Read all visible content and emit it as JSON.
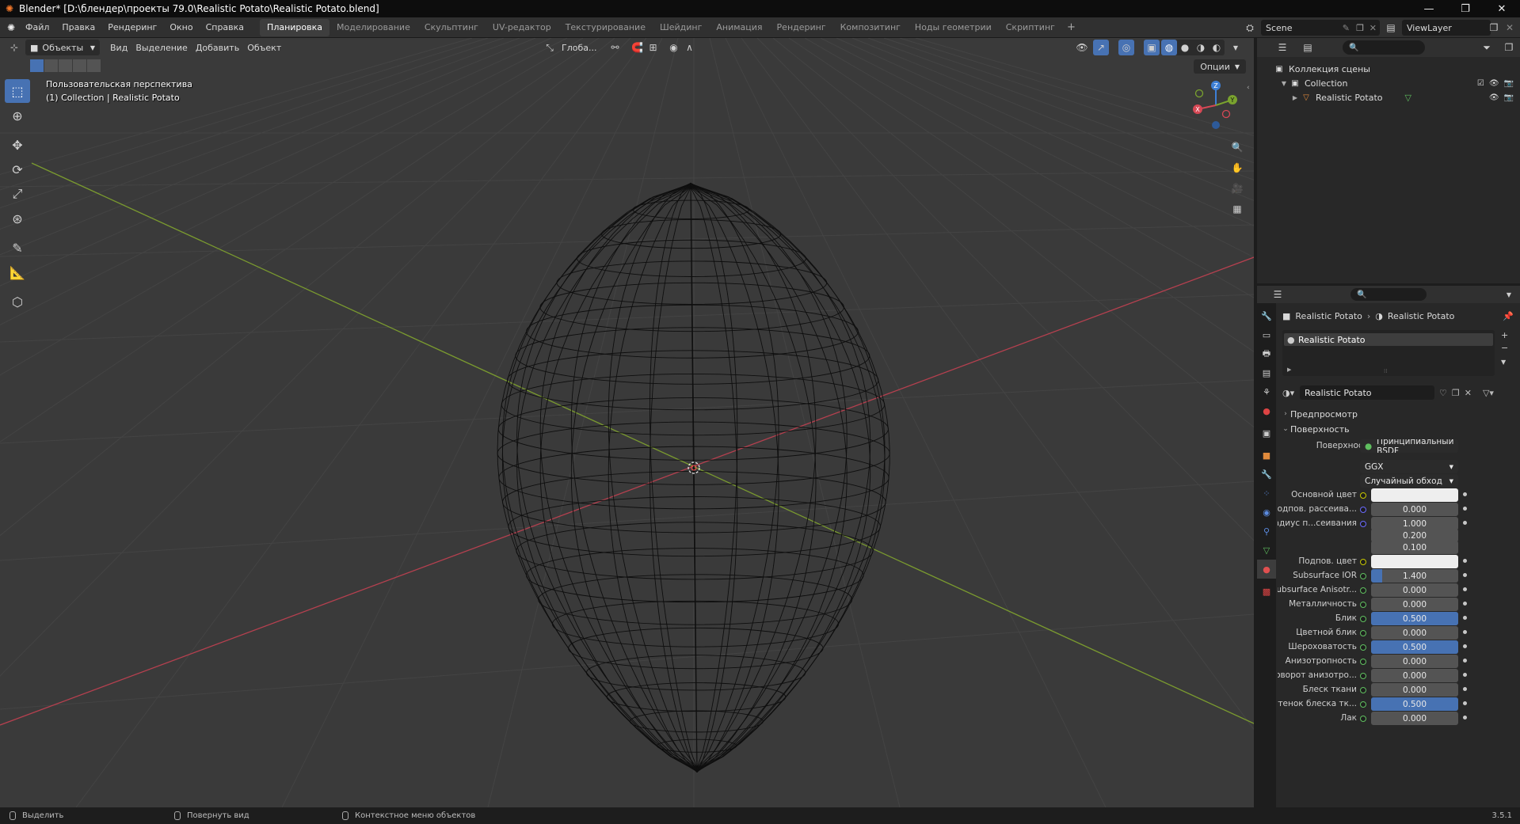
{
  "window": {
    "title": "Blender* [D:\\блендер\\проекты 79.0\\Realistic Potato\\Realistic Potato.blend]"
  },
  "menu": [
    "Файл",
    "Правка",
    "Рендеринг",
    "Окно",
    "Справка"
  ],
  "workspaces": [
    "Планировка",
    "Моделирование",
    "Скульптинг",
    "UV-редактор",
    "Текстурирование",
    "Шейдинг",
    "Анимация",
    "Рендеринг",
    "Композитинг",
    "Ноды геометрии",
    "Скриптинг"
  ],
  "scene": {
    "name": "Scene",
    "view_layer": "ViewLayer"
  },
  "viewport": {
    "mode": "Объекты",
    "menus": [
      "Вид",
      "Выделение",
      "Добавить",
      "Объект"
    ],
    "transform_orientation": "Глоба...",
    "options_label": "Опции",
    "info_line1": "Пользовательская перспектива",
    "info_line2": "(1) Collection | Realistic Potato",
    "gizmo": {
      "x": "X",
      "y": "Y",
      "z": "Z"
    }
  },
  "outliner": {
    "scene_collection": "Коллекция сцены",
    "collection": "Collection",
    "object": "Realistic Potato"
  },
  "properties": {
    "breadcrumb_object": "Realistic Potato",
    "breadcrumb_material": "Realistic Potato",
    "slot": "Realistic Potato",
    "material_name": "Realistic Potato",
    "panel_preview": "Предпросмотр",
    "panel_surface": "Поверхность",
    "surface_label": "Поверхность",
    "surface_value": "Принципиальный BSDF",
    "distribution": "GGX",
    "subsurface_method": "Случайный обход",
    "rows": [
      {
        "label": "Основной цвет",
        "value": "",
        "type": "color",
        "dot": "y"
      },
      {
        "label": "Подпов. рассеива...",
        "value": "0.000",
        "fill": 0,
        "dot": "b"
      },
      {
        "label": "Радиус п...сеивания",
        "value": "1.000",
        "fill": 0,
        "dot": "b"
      },
      {
        "label": "",
        "value": "0.200",
        "fill": 0,
        "dot": ""
      },
      {
        "label": "",
        "value": "0.100",
        "fill": 0,
        "dot": ""
      },
      {
        "label": "Подпов. цвет",
        "value": "",
        "type": "color",
        "dot": "y"
      },
      {
        "label": "Subsurface IOR",
        "value": "1.400",
        "fill": 0.13,
        "dot": "g"
      },
      {
        "label": "Subsurface Anisotr...",
        "value": "0.000",
        "fill": 0,
        "dot": "g"
      },
      {
        "label": "Металличность",
        "value": "0.000",
        "fill": 0,
        "dot": "g"
      },
      {
        "label": "Блик",
        "value": "0.500",
        "fill": 1,
        "dot": "g"
      },
      {
        "label": "Цветной блик",
        "value": "0.000",
        "fill": 0,
        "dot": "g"
      },
      {
        "label": "Шероховатость",
        "value": "0.500",
        "fill": 1,
        "dot": "g"
      },
      {
        "label": "Анизотропность",
        "value": "0.000",
        "fill": 0,
        "dot": "g"
      },
      {
        "label": "Поворот анизотро...",
        "value": "0.000",
        "fill": 0,
        "dot": "g"
      },
      {
        "label": "Блеск ткани",
        "value": "0.000",
        "fill": 0,
        "dot": "g"
      },
      {
        "label": "Оттенок блеска тк...",
        "value": "0.500",
        "fill": 1,
        "dot": "g"
      },
      {
        "label": "Лак",
        "value": "0.000",
        "fill": 0,
        "dot": "g"
      }
    ]
  },
  "statusbar": {
    "select": "Выделить",
    "rotate": "Повернуть вид",
    "context": "Контекстное меню объектов",
    "version": "3.5.1"
  },
  "colors": {
    "accent": "#4772b3",
    "x_axis": "#c24b5a",
    "y_axis": "#7a9a2f",
    "viewport_bg": "#3a3a3a"
  }
}
